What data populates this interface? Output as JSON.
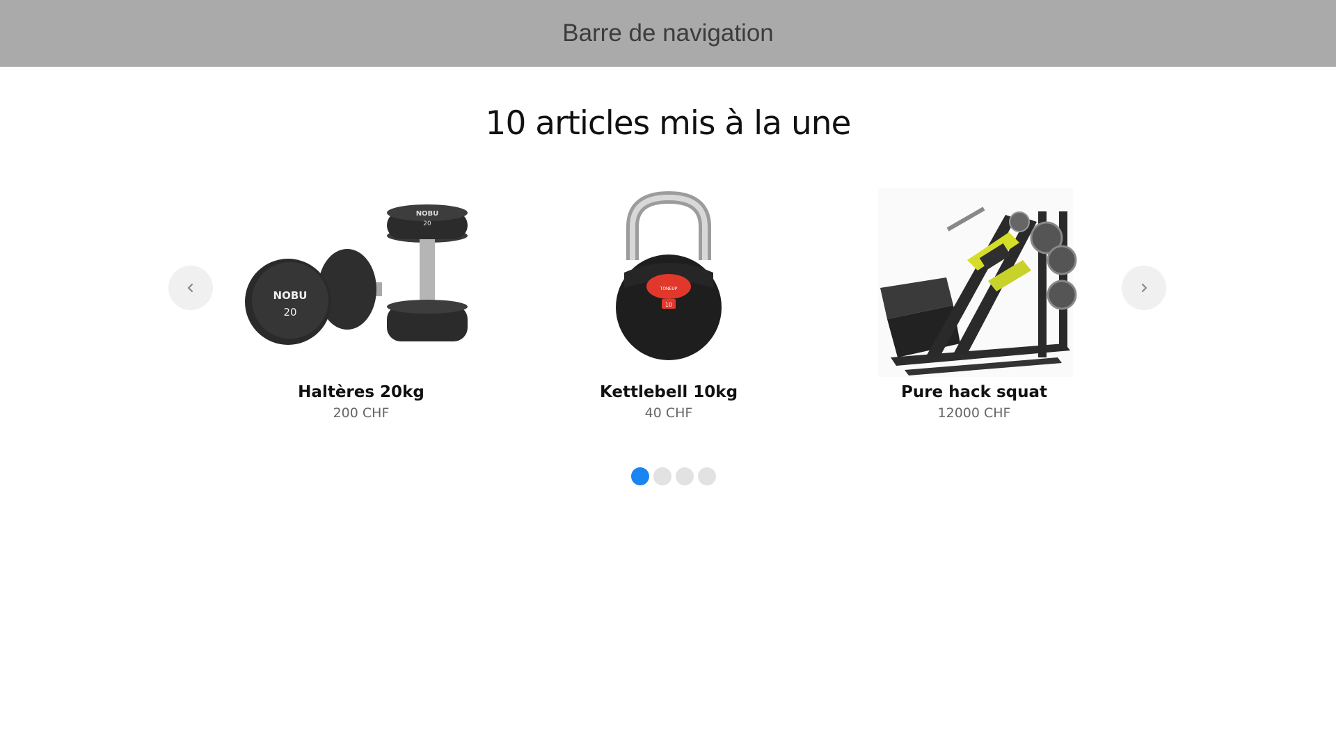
{
  "navbar": {
    "title": "Barre de navigation"
  },
  "featured": {
    "title": "10 articles mis à la une",
    "prev_icon": "chevron-left-icon",
    "next_icon": "chevron-right-icon",
    "products": [
      {
        "name": "Haltères 20kg",
        "price": "200 CHF",
        "image": "dumbbells-image"
      },
      {
        "name": "Kettlebell 10kg",
        "price": "40 CHF",
        "image": "kettlebell-image"
      },
      {
        "name": "Pure hack squat",
        "price": "12000 CHF",
        "image": "hack-squat-machine-image"
      }
    ],
    "pagination": {
      "pages": 4,
      "active_page": 1
    }
  },
  "colors": {
    "navbar_bg": "#aaaaaa",
    "accent": "#1a84f0",
    "dot_inactive": "#e2e2e2"
  }
}
